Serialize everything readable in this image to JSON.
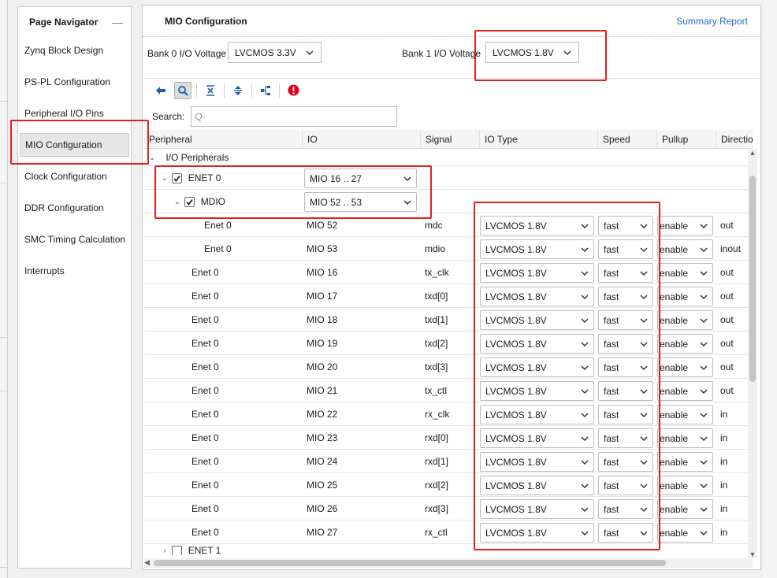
{
  "navigator": {
    "title": "Page Navigator",
    "minimize": "—",
    "items": [
      {
        "label": "Zynq Block Design"
      },
      {
        "label": "PS-PL Configuration"
      },
      {
        "label": "Peripheral I/O Pins"
      },
      {
        "label": "MIO Configuration"
      },
      {
        "label": "Clock Configuration"
      },
      {
        "label": "DDR Configuration"
      },
      {
        "label": "SMC Timing Calculation"
      },
      {
        "label": "Interrupts"
      }
    ],
    "active_index": 3
  },
  "main": {
    "title": "MIO Configuration",
    "summary_link": "Summary Report",
    "bank0": {
      "label": "Bank 0 I/O Voltage",
      "value": "LVCMOS 3.3V"
    },
    "bank1": {
      "label": "Bank 1 I/O Voltage",
      "value": "LVCMOS 1.8V"
    },
    "search": {
      "label": "Search:",
      "placeholder": "Q-"
    },
    "toolbar_icons": [
      "back-arrow-icon",
      "search-icon",
      "collapse-all-icon",
      "expand-all-icon",
      "hierarchy-icon",
      "error-icon"
    ],
    "accent_color": "#2a6ebb",
    "highlight_color": "#e02020"
  },
  "table": {
    "headers": {
      "peripheral": "Peripheral",
      "io": "IO",
      "signal": "Signal",
      "io_type": "IO Type",
      "speed": "Speed",
      "pullup": "Pullup",
      "direction": "Directio"
    },
    "group_label": "I/O Peripherals",
    "enet0": {
      "label": "ENET 0",
      "io": "MIO 16 .. 27",
      "checked": true
    },
    "mdio": {
      "label": "MDIO",
      "io": "MIO 52 .. 53",
      "checked": true
    },
    "rows": [
      {
        "peripheral": "Enet 0",
        "io": "MIO 52",
        "signal": "mdc",
        "io_type": "LVCMOS 1.8V",
        "speed": "fast",
        "pullup": "enable",
        "direction": "out"
      },
      {
        "peripheral": "Enet 0",
        "io": "MIO 53",
        "signal": "mdio",
        "io_type": "LVCMOS 1.8V",
        "speed": "fast",
        "pullup": "enable",
        "direction": "inout"
      },
      {
        "peripheral": "Enet 0",
        "io": "MIO 16",
        "signal": "tx_clk",
        "io_type": "LVCMOS 1.8V",
        "speed": "fast",
        "pullup": "enable",
        "direction": "out"
      },
      {
        "peripheral": "Enet 0",
        "io": "MIO 17",
        "signal": "txd[0]",
        "io_type": "LVCMOS 1.8V",
        "speed": "fast",
        "pullup": "enable",
        "direction": "out"
      },
      {
        "peripheral": "Enet 0",
        "io": "MIO 18",
        "signal": "txd[1]",
        "io_type": "LVCMOS 1.8V",
        "speed": "fast",
        "pullup": "enable",
        "direction": "out"
      },
      {
        "peripheral": "Enet 0",
        "io": "MIO 19",
        "signal": "txd[2]",
        "io_type": "LVCMOS 1.8V",
        "speed": "fast",
        "pullup": "enable",
        "direction": "out"
      },
      {
        "peripheral": "Enet 0",
        "io": "MIO 20",
        "signal": "txd[3]",
        "io_type": "LVCMOS 1.8V",
        "speed": "fast",
        "pullup": "enable",
        "direction": "out"
      },
      {
        "peripheral": "Enet 0",
        "io": "MIO 21",
        "signal": "tx_ctl",
        "io_type": "LVCMOS 1.8V",
        "speed": "fast",
        "pullup": "enable",
        "direction": "out"
      },
      {
        "peripheral": "Enet 0",
        "io": "MIO 22",
        "signal": "rx_clk",
        "io_type": "LVCMOS 1.8V",
        "speed": "fast",
        "pullup": "enable",
        "direction": "in"
      },
      {
        "peripheral": "Enet 0",
        "io": "MIO 23",
        "signal": "rxd[0]",
        "io_type": "LVCMOS 1.8V",
        "speed": "fast",
        "pullup": "enable",
        "direction": "in"
      },
      {
        "peripheral": "Enet 0",
        "io": "MIO 24",
        "signal": "rxd[1]",
        "io_type": "LVCMOS 1.8V",
        "speed": "fast",
        "pullup": "enable",
        "direction": "in"
      },
      {
        "peripheral": "Enet 0",
        "io": "MIO 25",
        "signal": "rxd[2]",
        "io_type": "LVCMOS 1.8V",
        "speed": "fast",
        "pullup": "enable",
        "direction": "in"
      },
      {
        "peripheral": "Enet 0",
        "io": "MIO 26",
        "signal": "rxd[3]",
        "io_type": "LVCMOS 1.8V",
        "speed": "fast",
        "pullup": "enable",
        "direction": "in"
      },
      {
        "peripheral": "Enet 0",
        "io": "MIO 27",
        "signal": "rx_ctl",
        "io_type": "LVCMOS 1.8V",
        "speed": "fast",
        "pullup": "enable",
        "direction": "in"
      }
    ],
    "enet1": {
      "label": "ENET 1",
      "checked": false
    }
  }
}
